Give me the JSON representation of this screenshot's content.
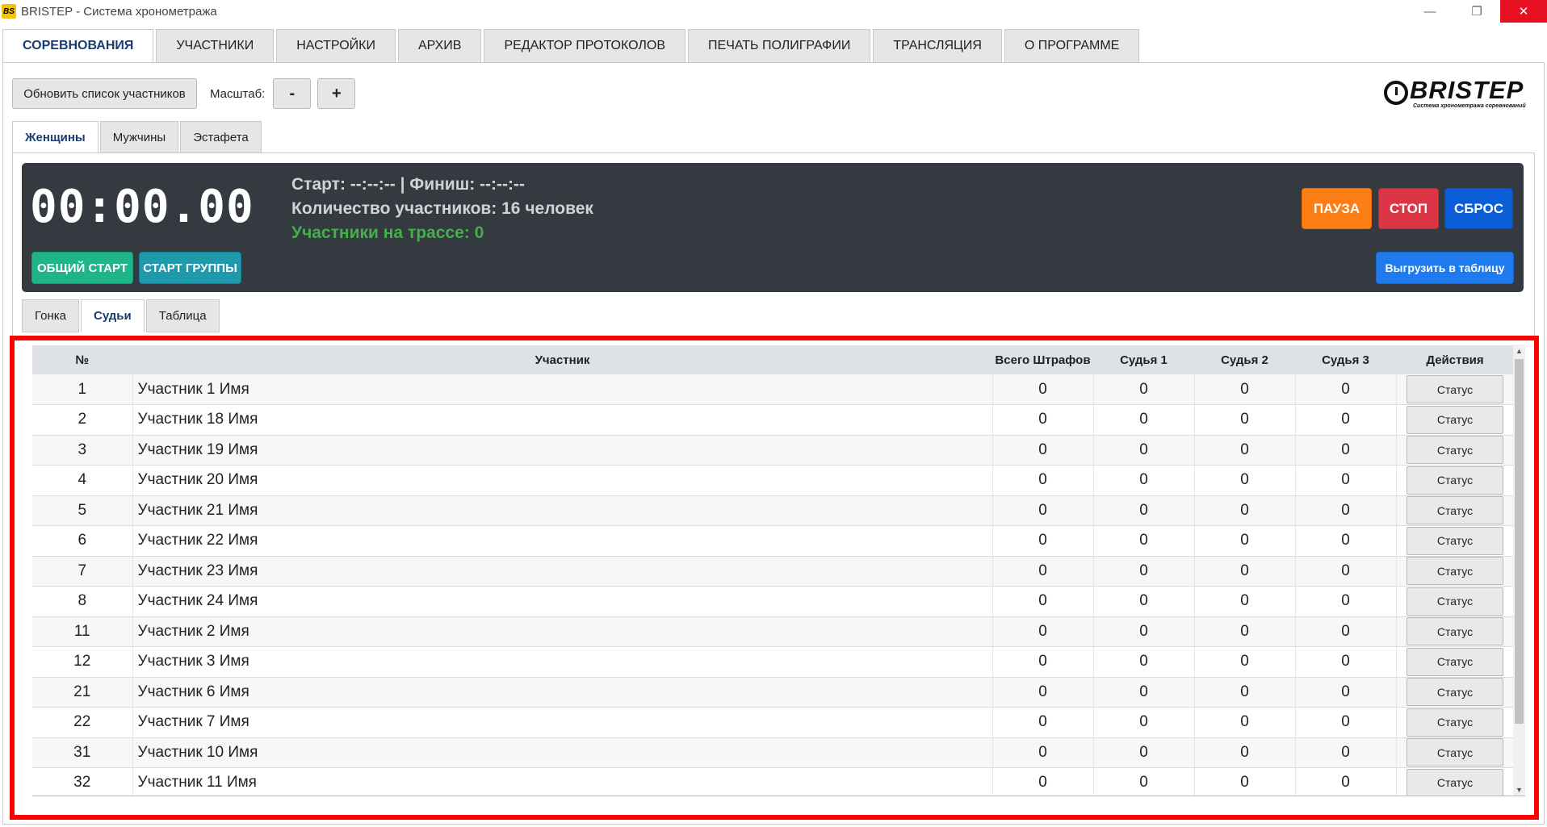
{
  "window": {
    "app_icon": "BS",
    "title": "BRISTEP - Система хронометража",
    "minimize": "—",
    "maximize": "❐",
    "close": "✕"
  },
  "main_tabs": [
    {
      "label": "СОРЕВНОВАНИЯ",
      "active": true
    },
    {
      "label": "УЧАСТНИКИ"
    },
    {
      "label": "НАСТРОЙКИ"
    },
    {
      "label": "АРХИВ"
    },
    {
      "label": "РЕДАКТОР ПРОТОКОЛОВ"
    },
    {
      "label": "ПЕЧАТЬ ПОЛИГРАФИИ"
    },
    {
      "label": "ТРАНСЛЯЦИЯ"
    },
    {
      "label": "О ПРОГРАММЕ"
    }
  ],
  "toolbar": {
    "refresh_label": "Обновить список участников",
    "scale_label": "Масштаб:",
    "zoom_out": "-",
    "zoom_in": "+"
  },
  "logo": {
    "text": "BRISTEP",
    "subtitle": "Система хронометража соревнований"
  },
  "gender_tabs": [
    {
      "label": "Женщины",
      "active": true
    },
    {
      "label": "Мужчины"
    },
    {
      "label": "Эстафета"
    }
  ],
  "timer_panel": {
    "time": "00:00.00",
    "start_finish": "Старт: --:--:-- | Финиш: --:--:--",
    "participants_count": "Количество участников: 16 человек",
    "on_track": "Участники на трассе: 0",
    "common_start": "ОБЩИЙ СТАРТ",
    "group_start": "СТАРТ ГРУППЫ",
    "pause": "ПАУЗА",
    "stop": "СТОП",
    "reset": "СБРОС",
    "export": "Выгрузить в таблицу"
  },
  "sub_tabs": [
    {
      "label": "Гонка"
    },
    {
      "label": "Судьи",
      "active": true
    },
    {
      "label": "Таблица"
    }
  ],
  "table": {
    "headers": [
      "№",
      "Участник",
      "Всего Штрафов",
      "Судья 1",
      "Судья 2",
      "Судья 3",
      "Действия"
    ],
    "action_label": "Статус",
    "rows": [
      {
        "num": "1",
        "name": "Участник 1 Имя",
        "total": "0",
        "j1": "0",
        "j2": "0",
        "j3": "0"
      },
      {
        "num": "2",
        "name": "Участник 18 Имя",
        "total": "0",
        "j1": "0",
        "j2": "0",
        "j3": "0"
      },
      {
        "num": "3",
        "name": "Участник 19 Имя",
        "total": "0",
        "j1": "0",
        "j2": "0",
        "j3": "0"
      },
      {
        "num": "4",
        "name": "Участник 20 Имя",
        "total": "0",
        "j1": "0",
        "j2": "0",
        "j3": "0"
      },
      {
        "num": "5",
        "name": "Участник 21 Имя",
        "total": "0",
        "j1": "0",
        "j2": "0",
        "j3": "0"
      },
      {
        "num": "6",
        "name": "Участник 22 Имя",
        "total": "0",
        "j1": "0",
        "j2": "0",
        "j3": "0"
      },
      {
        "num": "7",
        "name": "Участник 23 Имя",
        "total": "0",
        "j1": "0",
        "j2": "0",
        "j3": "0"
      },
      {
        "num": "8",
        "name": "Участник 24 Имя",
        "total": "0",
        "j1": "0",
        "j2": "0",
        "j3": "0"
      },
      {
        "num": "11",
        "name": "Участник 2 Имя",
        "total": "0",
        "j1": "0",
        "j2": "0",
        "j3": "0"
      },
      {
        "num": "12",
        "name": "Участник 3 Имя",
        "total": "0",
        "j1": "0",
        "j2": "0",
        "j3": "0"
      },
      {
        "num": "21",
        "name": "Участник 6 Имя",
        "total": "0",
        "j1": "0",
        "j2": "0",
        "j3": "0"
      },
      {
        "num": "22",
        "name": "Участник 7 Имя",
        "total": "0",
        "j1": "0",
        "j2": "0",
        "j3": "0"
      },
      {
        "num": "31",
        "name": "Участник 10 Имя",
        "total": "0",
        "j1": "0",
        "j2": "0",
        "j3": "0"
      },
      {
        "num": "32",
        "name": "Участник 11 Имя",
        "total": "0",
        "j1": "0",
        "j2": "0",
        "j3": "0"
      }
    ]
  },
  "colors": {
    "highlight": "#ff0000",
    "dark_panel": "#343a40",
    "on_track_green": "#43b049",
    "pause": "#fd7e14",
    "stop": "#dc3545",
    "reset": "#0b5ed7",
    "export": "#1f7af0",
    "common_start": "#1fb589",
    "group_start": "#1f9aad"
  }
}
